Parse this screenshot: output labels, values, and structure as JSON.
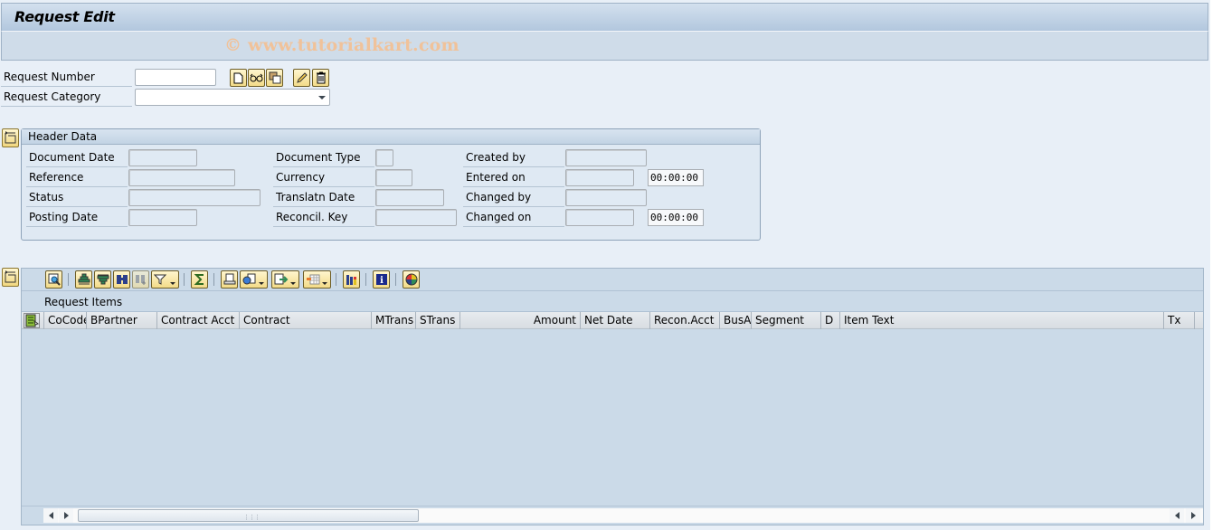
{
  "window": {
    "title": "Request Edit",
    "watermark": "© www.tutorialkart.com"
  },
  "selection": {
    "request_number": {
      "label": "Request Number",
      "value": ""
    },
    "request_category": {
      "label": "Request Category",
      "value": ""
    },
    "toolbar": [
      {
        "name": "create-icon",
        "tooltip": "Create"
      },
      {
        "name": "display-icon",
        "tooltip": "Display"
      },
      {
        "name": "copy-icon",
        "tooltip": "Copy"
      },
      {
        "name": "change-icon",
        "tooltip": "Change"
      },
      {
        "name": "delete-icon",
        "tooltip": "Delete"
      }
    ]
  },
  "header_data": {
    "title": "Header Data",
    "fields": {
      "document_date": {
        "label": "Document Date",
        "value": ""
      },
      "reference": {
        "label": "Reference",
        "value": ""
      },
      "status": {
        "label": "Status",
        "value": ""
      },
      "posting_date": {
        "label": "Posting Date",
        "value": ""
      },
      "document_type": {
        "label": "Document Type",
        "value": ""
      },
      "currency": {
        "label": "Currency",
        "value": ""
      },
      "translatn_date": {
        "label": "Translatn Date",
        "value": ""
      },
      "reconcil_key": {
        "label": "Reconcil. Key",
        "value": ""
      },
      "created_by": {
        "label": "Created by",
        "value": ""
      },
      "entered_on": {
        "label": "Entered on",
        "value": "",
        "time": "00:00:00"
      },
      "changed_by": {
        "label": "Changed by",
        "value": ""
      },
      "changed_on": {
        "label": "Changed on",
        "value": "",
        "time": "00:00:00"
      }
    }
  },
  "items": {
    "title": "Request Items",
    "toolbar": [
      "details-icon",
      "sort-ascending-icon",
      "sort-descending-icon",
      "find-icon",
      "find-next-icon",
      "filter-icon",
      "sum-icon",
      "print-preview-icon",
      "views-icon",
      "export-icon",
      "layout-icon",
      "graphic-icon",
      "info-icon",
      "color-legend-icon"
    ],
    "columns": [
      "CoCode",
      "BPartner",
      "Contract Acct",
      "Contract",
      "MTrans",
      "STrans",
      "Amount",
      "Net Date",
      "Recon.Acct",
      "BusA",
      "Segment",
      "D",
      "Item Text",
      "Tx"
    ],
    "rows": []
  }
}
